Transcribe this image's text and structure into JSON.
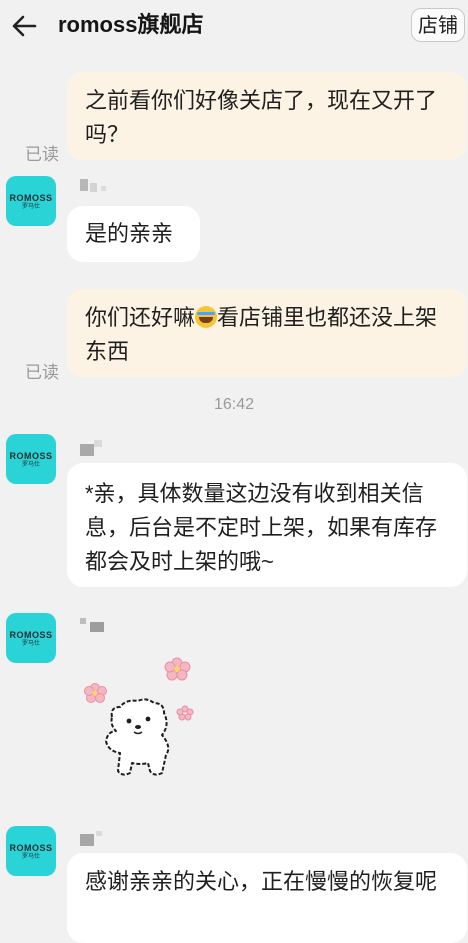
{
  "header": {
    "title": "romoss旗舰店",
    "store_button": "店铺"
  },
  "avatar": {
    "brand": "ROMOSS",
    "sub": "罗马仕"
  },
  "messages": {
    "m1": {
      "side": "right",
      "text": "之前看你们好像关店了，现在又开了吗？",
      "status": "已读"
    },
    "m2": {
      "side": "left",
      "text": "是的亲亲"
    },
    "m3": {
      "side": "right",
      "text_before": "你们还好嘛",
      "text_after": "看店铺里也都还没上架东西",
      "status": "已读"
    },
    "time": "16:42",
    "m4": {
      "side": "left",
      "text": "*亲，具体数量这边没有收到相关信息，后台是不定时上架，如果有库存都会及时上架的哦~"
    },
    "m5": {
      "side": "left",
      "type": "sticker",
      "sticker": "bear-with-flowers"
    },
    "m6": {
      "side": "left",
      "text": "感谢亲亲的关心，正在慢慢的恢复呢"
    }
  },
  "icons": {
    "back": "arrow-left-icon",
    "emoji": "tears-of-joy-emoji-icon"
  }
}
